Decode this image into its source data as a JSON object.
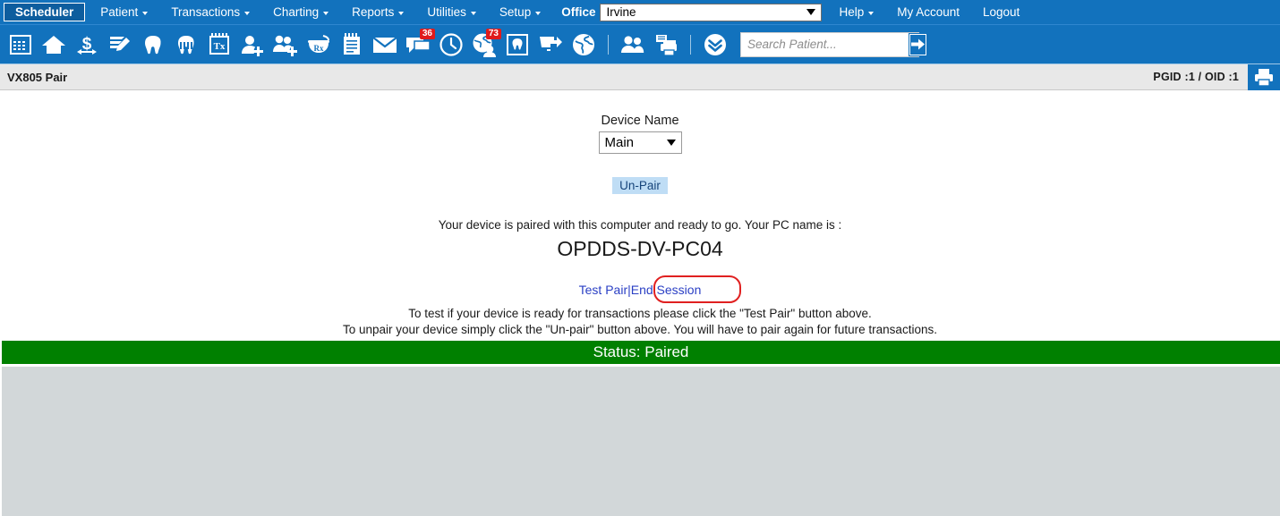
{
  "menubar": {
    "items": [
      {
        "label": "Scheduler",
        "active": true,
        "caret": false
      },
      {
        "label": "Patient",
        "active": false,
        "caret": true
      },
      {
        "label": "Transactions",
        "active": false,
        "caret": true
      },
      {
        "label": "Charting",
        "active": false,
        "caret": true
      },
      {
        "label": "Reports",
        "active": false,
        "caret": true
      },
      {
        "label": "Utilities",
        "active": false,
        "caret": true
      },
      {
        "label": "Setup",
        "active": false,
        "caret": true
      }
    ],
    "office_label": "Office",
    "office_value": "Irvine",
    "right_items": [
      {
        "label": "Help",
        "caret": true
      },
      {
        "label": "My Account",
        "caret": false
      },
      {
        "label": "Logout",
        "caret": false
      }
    ]
  },
  "toolbar": {
    "icons": [
      {
        "name": "calendar-grid-icon",
        "badge": ""
      },
      {
        "name": "home-icon",
        "badge": ""
      },
      {
        "name": "dollar-transfer-icon",
        "badge": ""
      },
      {
        "name": "notes-edit-icon",
        "badge": ""
      },
      {
        "name": "tooth-icon",
        "badge": ""
      },
      {
        "name": "tooth-perio-icon",
        "badge": ""
      },
      {
        "name": "treatment-plan-icon",
        "badge": ""
      },
      {
        "name": "add-patient-icon",
        "badge": ""
      },
      {
        "name": "add-family-icon",
        "badge": ""
      },
      {
        "name": "prescription-icon",
        "badge": ""
      },
      {
        "name": "clipboard-notes-icon",
        "badge": ""
      },
      {
        "name": "envelope-mail-icon",
        "badge": ""
      },
      {
        "name": "chat-messages-icon",
        "badge": "36"
      },
      {
        "name": "clock-icon",
        "badge": ""
      },
      {
        "name": "globe-contact-icon",
        "badge": "73"
      },
      {
        "name": "tooth-box-icon",
        "badge": ""
      },
      {
        "name": "screen-share-icon",
        "badge": ""
      },
      {
        "name": "globe-icon",
        "badge": ""
      },
      {
        "name": "users-icon",
        "badge": ""
      },
      {
        "name": "print-copy-icon",
        "badge": ""
      },
      {
        "name": "double-chevron-down-icon",
        "badge": ""
      }
    ],
    "search_placeholder": "Search Patient...",
    "search_value": "",
    "go_button": "go-arrow-icon"
  },
  "titlebar": {
    "title": "VX805 Pair",
    "ids": "PGID :1 / OID :1",
    "print_icon": "printer-icon"
  },
  "main": {
    "device_name_label": "Device Name",
    "device_name_value": "Main",
    "unpair_button": "Un-Pair",
    "paired_message": "Your device is paired with this computer and ready to go. Your PC name is :",
    "pc_name": "OPDDS-DV-PC04",
    "test_pair_link": "Test Pair",
    "separator": "|",
    "end_session_link": "End Session",
    "instruction_1": "To test if your device is ready for transactions please click the \"Test Pair\" button above.",
    "instruction_2": "To unpair your device simply click the \"Un-pair\" button above. You will have to pair again for future transactions."
  },
  "status": {
    "text": "Status: Paired"
  },
  "colors": {
    "nav_blue": "#1272bd",
    "active_tab_blue": "#0d5d9e",
    "status_green": "#008000",
    "badge_red": "#e01b1b",
    "link_blue": "#2a3fc4",
    "annotation_red": "#e02020",
    "unpair_bg": "#bfddf5",
    "panel_gray": "#d2d7d9"
  }
}
